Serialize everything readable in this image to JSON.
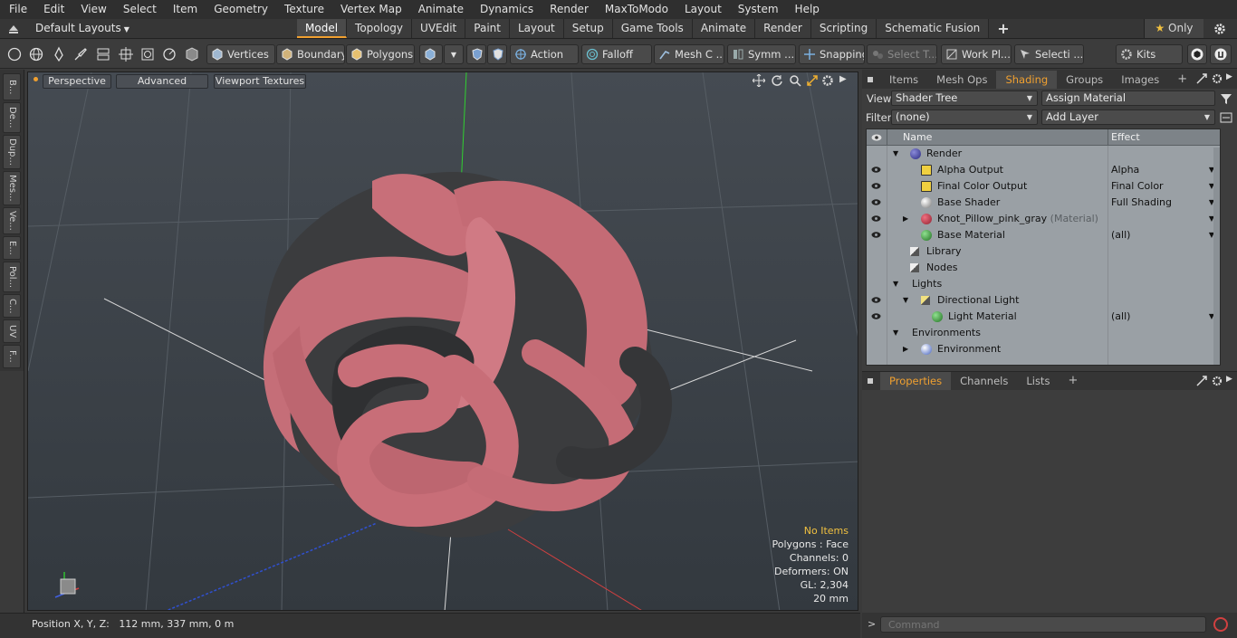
{
  "menu": [
    "File",
    "Edit",
    "View",
    "Select",
    "Item",
    "Geometry",
    "Texture",
    "Vertex Map",
    "Animate",
    "Dynamics",
    "Render",
    "MaxToModo",
    "Layout",
    "System",
    "Help"
  ],
  "layout": {
    "preset": "Default Layouts",
    "tabs": [
      "Model",
      "Topology",
      "UVEdit",
      "Paint",
      "Layout",
      "Setup",
      "Game Tools",
      "Animate",
      "Render",
      "Scripting",
      "Schematic Fusion"
    ],
    "active_tab": "Model",
    "add": "+",
    "only_label": "Only"
  },
  "toolbar": {
    "vertices": "Vertices",
    "boundary": "Boundary",
    "polygons": "Polygons",
    "action": "Action",
    "falloff": "Falloff",
    "mesh_c": "Mesh C ...",
    "symm": "Symm ...",
    "snapping": "Snapping",
    "select_t": "Select T...",
    "work_pl": "Work Pl...",
    "selecti": "Selecti ...",
    "kits": "Kits"
  },
  "left_tabs": [
    "B...",
    "De...",
    "Dup...",
    "Mes...",
    "Ve...",
    "E...",
    "Pol...",
    "C...",
    "UV",
    "F..."
  ],
  "viewport": {
    "perspective": "Perspective",
    "advanced": "Advanced",
    "textures": "Viewport Textures",
    "info": {
      "no_items": "No Items",
      "polygons": "Polygons : Face",
      "channels": "Channels: 0",
      "deformers": "Deformers: ON",
      "gl": "GL: 2,304",
      "scale": "20 mm"
    }
  },
  "status": {
    "position_label": "Position X, Y, Z:",
    "position_value": "112 mm, 337 mm, 0 m"
  },
  "panel": {
    "tabs": [
      "Items",
      "Mesh Ops",
      "Shading",
      "Groups",
      "Images"
    ],
    "active_tab": "Shading",
    "add": "+",
    "view_label": "View",
    "view_value": "Shader Tree",
    "assign_material": "Assign Material",
    "filter_label": "Filter",
    "filter_value": "(none)",
    "add_layer": "Add Layer",
    "tree_header": {
      "name": "Name",
      "effect": "Effect"
    },
    "tree_rows": [
      {
        "label": "Render",
        "effect": "",
        "suffix": ""
      },
      {
        "label": "Alpha Output",
        "effect": "Alpha",
        "suffix": ""
      },
      {
        "label": "Final Color Output",
        "effect": "Final Color",
        "suffix": ""
      },
      {
        "label": "Base Shader",
        "effect": "Full Shading",
        "suffix": ""
      },
      {
        "label": "Knot_Pillow_pink_gray",
        "effect": "",
        "suffix": "(Material)"
      },
      {
        "label": "Base Material",
        "effect": "(all)",
        "suffix": ""
      },
      {
        "label": "Library",
        "effect": "",
        "suffix": ""
      },
      {
        "label": "Nodes",
        "effect": "",
        "suffix": ""
      },
      {
        "label": "Lights",
        "effect": "",
        "suffix": ""
      },
      {
        "label": "Directional Light",
        "effect": "",
        "suffix": ""
      },
      {
        "label": "Light Material",
        "effect": "(all)",
        "suffix": ""
      },
      {
        "label": "Environments",
        "effect": "",
        "suffix": ""
      },
      {
        "label": "Environment",
        "effect": "",
        "suffix": ""
      }
    ],
    "prop_tabs": [
      "Properties",
      "Channels",
      "Lists"
    ],
    "prop_active": "Properties",
    "command_placeholder": "Command"
  },
  "colors": {
    "accent": "#f0a030",
    "knot_pink": "#c9707a",
    "knot_gray": "#3a3b3d"
  }
}
